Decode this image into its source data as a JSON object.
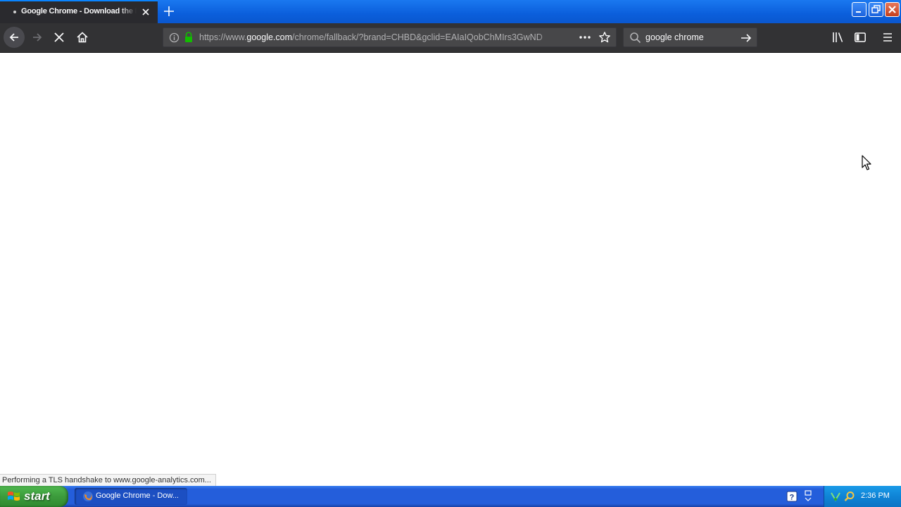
{
  "browser": {
    "tab": {
      "title": "Google Chrome - Download the Fast, Secure Browser from Google"
    },
    "url": {
      "prefix": "https://www.",
      "host": "google.com",
      "path": "/chrome/fallback/?brand=CHBD&gclid=EAIaIQobChMIrs3GwND"
    },
    "search": {
      "value": "google chrome"
    },
    "status": "Performing a TLS handshake to www.google-analytics.com..."
  },
  "taskbar": {
    "start_label": "start",
    "task_label": "Google Chrome - Dow...",
    "clock": "2:36 PM"
  }
}
